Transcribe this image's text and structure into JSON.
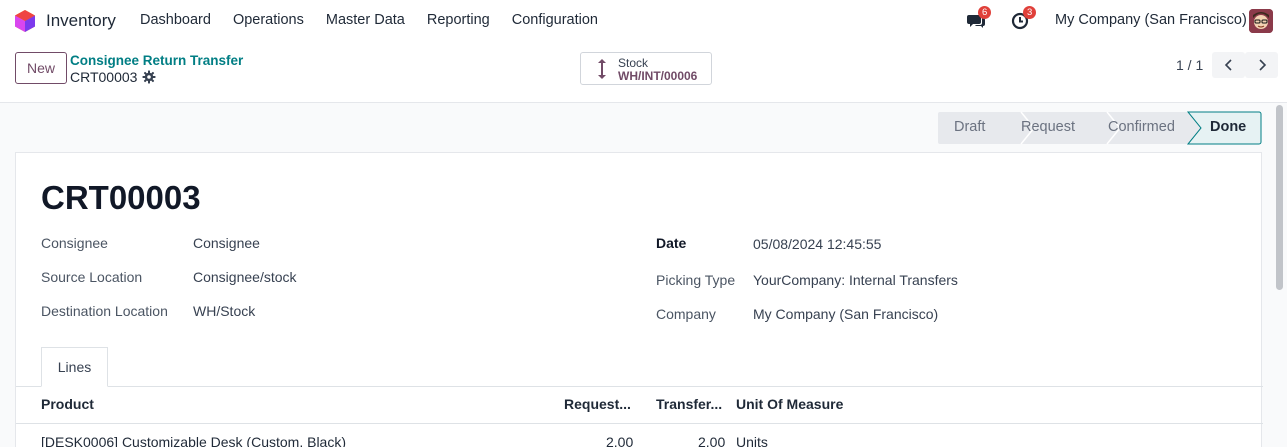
{
  "navbar": {
    "app_name": "Inventory",
    "menu": [
      "Dashboard",
      "Operations",
      "Master Data",
      "Reporting",
      "Configuration"
    ],
    "messages_count": "6",
    "activities_count": "3",
    "company": "My Company (San Francisco)"
  },
  "control": {
    "new_label": "New",
    "breadcrumb_parent": "Consignee Return Transfer",
    "breadcrumb_current": "CRT00003",
    "smart_button": {
      "title": "Stock",
      "value": "WH/INT/00006"
    },
    "pager": "1 / 1"
  },
  "statusbar": {
    "stages": [
      "Draft",
      "Request",
      "Confirmed",
      "Done"
    ],
    "current": "Done"
  },
  "form": {
    "name": "CRT00003",
    "fields_left": [
      {
        "label": "Consignee",
        "value": "Consignee"
      },
      {
        "label": "Source Location",
        "value": "Consignee/stock"
      },
      {
        "label": "Destination Location",
        "value": "WH/Stock"
      }
    ],
    "fields_right": [
      {
        "label": "Date",
        "value": "05/08/2024 12:45:55"
      },
      {
        "label": "Picking Type",
        "value": "YourCompany: Internal Transfers"
      },
      {
        "label": "Company",
        "value": "My Company (San Francisco)"
      }
    ],
    "tab_label": "Lines",
    "table": {
      "headers": [
        "Product",
        "Request...",
        "Transfer...",
        "Unit Of Measure"
      ],
      "rows": [
        [
          "[DESK0006] Customizable Desk (Custom, Black)",
          "2.00",
          "2.00",
          "Units"
        ]
      ]
    }
  },
  "colors": {
    "primary": "#714b67",
    "link": "#017e84",
    "badge": "#e0403a"
  }
}
